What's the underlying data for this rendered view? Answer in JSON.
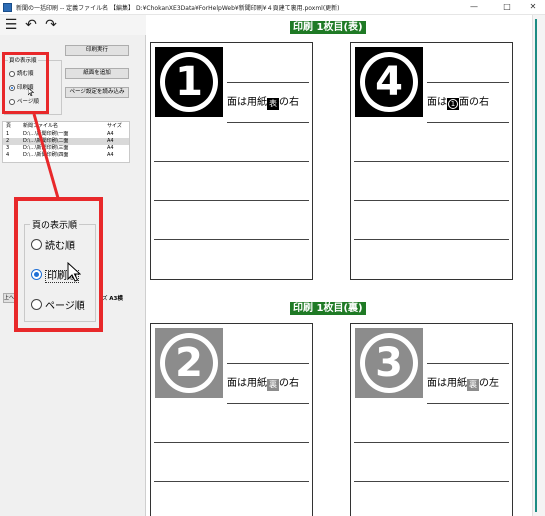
{
  "window": {
    "title": "新聞の一括印刷 -- 定義ファイル名 【編集】 D:¥ChokanXE3Data¥ForHelpWeb¥新聞印刷¥４頁建て裏用.poxml(更新)",
    "minimize_glyph": "—",
    "maximize_glyph": "□",
    "close_glyph": "✕"
  },
  "toolbar": {
    "menu_glyph": "☰",
    "undo_glyph": "↶",
    "redo_glyph": "↷"
  },
  "left_panel": {
    "order_group": {
      "legend": "頁の表示順",
      "options": [
        "読む順",
        "印刷順",
        "ページ順"
      ],
      "selected_index": 1
    },
    "buttons": {
      "print": "印刷実行",
      "add_paper": "紙面を追加",
      "load_page_settings": "ページ設定を読み込み"
    },
    "file_list": {
      "headers": [
        "頁",
        "新聞ファイル名",
        "サイズ"
      ],
      "rows": [
        {
          "page": "1",
          "file": "D:\\...\\新聞印刷\\一面",
          "size": "A4"
        },
        {
          "page": "2",
          "file": "D:\\...\\新聞印刷\\二面",
          "size": "A4"
        },
        {
          "page": "3",
          "file": "D:\\...\\新聞印刷\\三面",
          "size": "A4"
        },
        {
          "page": "4",
          "file": "D:\\...\\新聞印刷\\四面",
          "size": "A4"
        }
      ],
      "selected_row": 1
    },
    "bottom_button": "上へ",
    "size_label": "ズ",
    "size_value": "A3横"
  },
  "callout": {
    "legend": "頁の表示順",
    "options": [
      "読む順",
      "印刷順",
      "ページ順"
    ],
    "selected_index": 1
  },
  "preview": {
    "sheets": [
      {
        "label": "印刷 1枚目(表)",
        "pages": [
          {
            "number": "1",
            "style": "black",
            "text_before": "面は用紙",
            "mark": "表",
            "text_after": "の右"
          },
          {
            "number": "4",
            "style": "black",
            "text_before": "面は",
            "mark": "1",
            "text_after": "面の右"
          }
        ]
      },
      {
        "label": "印刷 1枚目(裏)",
        "pages": [
          {
            "number": "2",
            "style": "gray",
            "text_before": "面は用紙",
            "mark": "裏",
            "text_after": "の右"
          },
          {
            "number": "3",
            "style": "gray",
            "text_before": "面は用紙",
            "mark": "裏",
            "text_after": "の左"
          }
        ]
      }
    ]
  }
}
